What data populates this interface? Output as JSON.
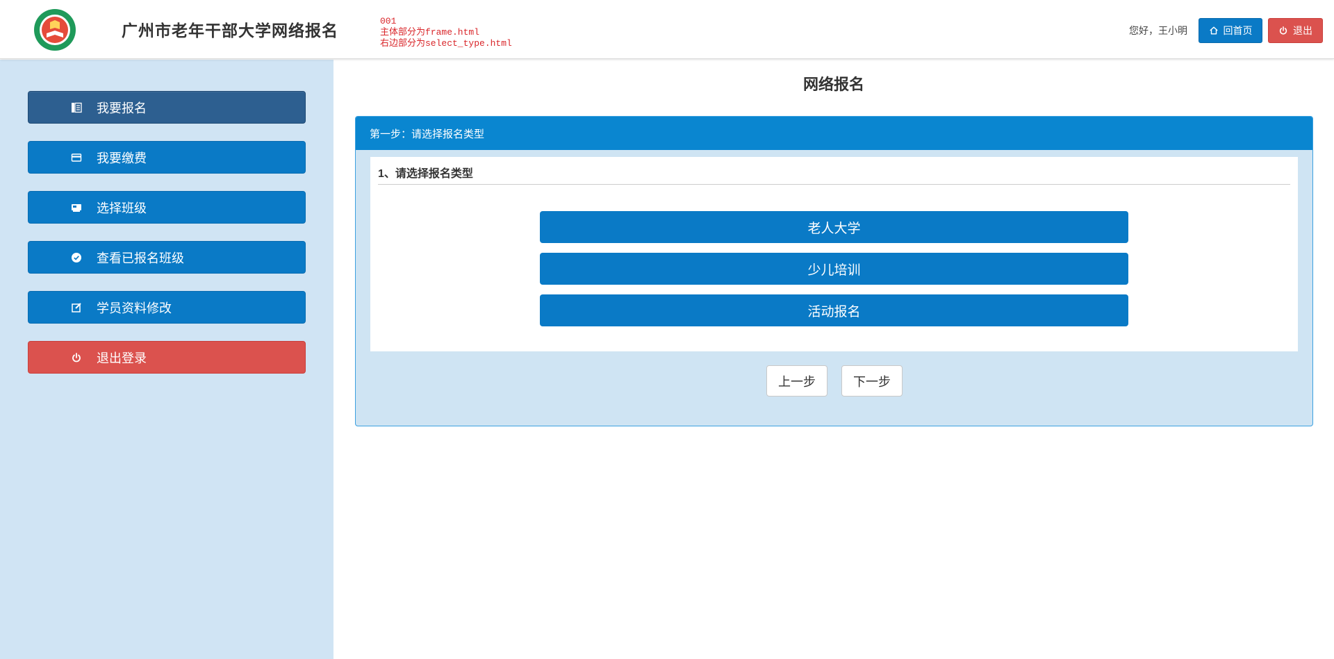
{
  "header": {
    "site_title": "广州市老年干部大学网络报名",
    "dev_note": [
      "001",
      "主体部分为frame.html",
      "右边部分为select_type.html"
    ],
    "greeting": "您好，王小明",
    "home_label": "回首页",
    "logout_label": "退出"
  },
  "sidebar": {
    "items": [
      {
        "label": "我要报名",
        "icon": "enroll-icon",
        "state": "active"
      },
      {
        "label": "我要缴费",
        "icon": "card-icon"
      },
      {
        "label": "选择班级",
        "icon": "class-icon"
      },
      {
        "label": "查看已报名班级",
        "icon": "check-circle-icon"
      },
      {
        "label": "学员资料修改",
        "icon": "edit-icon"
      },
      {
        "label": "退出登录",
        "icon": "power-icon",
        "style": "danger"
      }
    ]
  },
  "main": {
    "page_title": "网络报名",
    "panel_heading": "第一步：请选择报名类型",
    "section_title": "1、请选择报名类型",
    "types": [
      "老人大学",
      "少儿培训",
      "活动报名"
    ],
    "prev_label": "上一步",
    "next_label": "下一步"
  },
  "colors": {
    "primary": "#0a7ac6",
    "active_nav": "#2d5f90",
    "danger": "#db524e",
    "sidebar_bg": "#d0e4f4",
    "panel_heading": "#0a86d0",
    "dev_note": "#d9262a"
  }
}
